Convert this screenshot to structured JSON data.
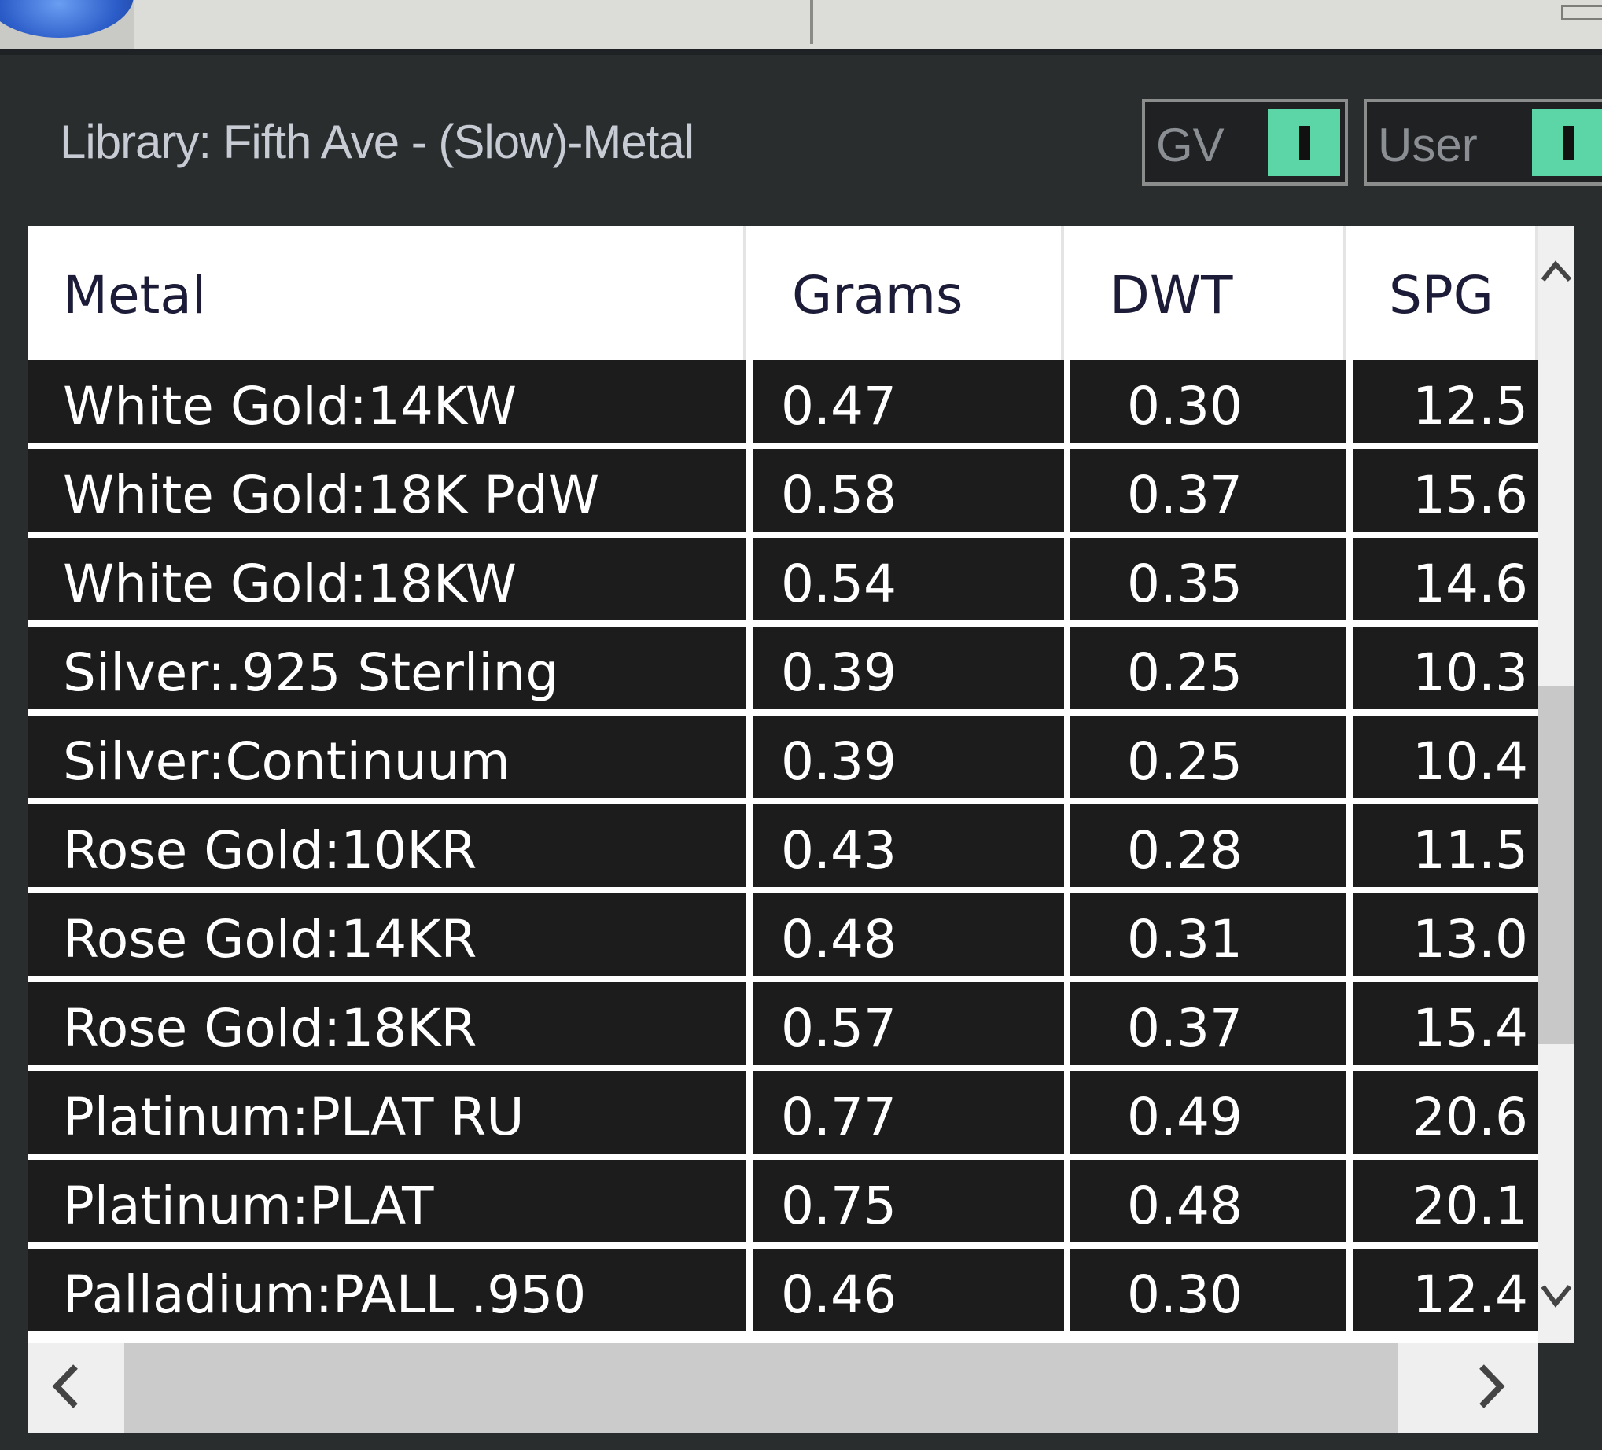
{
  "header": {
    "library_title": "Library: Fifth Ave - (Slow)-Metal",
    "toggles": [
      {
        "label": "GV",
        "state": "on"
      },
      {
        "label": "User",
        "state": "on"
      }
    ]
  },
  "table": {
    "columns": [
      "Metal",
      "Grams",
      "DWT",
      "SPG"
    ],
    "rows": [
      {
        "metal": "White Gold:14KW",
        "grams": "0.47",
        "dwt": "0.30",
        "spg": "12.5"
      },
      {
        "metal": "White Gold:18K PdW",
        "grams": "0.58",
        "dwt": "0.37",
        "spg": "15.6"
      },
      {
        "metal": "White Gold:18KW",
        "grams": "0.54",
        "dwt": "0.35",
        "spg": "14.6"
      },
      {
        "metal": "Silver:.925 Sterling",
        "grams": "0.39",
        "dwt": "0.25",
        "spg": "10.3"
      },
      {
        "metal": "Silver:Continuum",
        "grams": "0.39",
        "dwt": "0.25",
        "spg": "10.4"
      },
      {
        "metal": "Rose Gold:10KR",
        "grams": "0.43",
        "dwt": "0.28",
        "spg": "11.5"
      },
      {
        "metal": "Rose Gold:14KR",
        "grams": "0.48",
        "dwt": "0.31",
        "spg": "13.0"
      },
      {
        "metal": "Rose Gold:18KR",
        "grams": "0.57",
        "dwt": "0.37",
        "spg": "15.4"
      },
      {
        "metal": "Platinum:PLAT RU",
        "grams": "0.77",
        "dwt": "0.49",
        "spg": "20.6"
      },
      {
        "metal": "Platinum:PLAT",
        "grams": "0.75",
        "dwt": "0.48",
        "spg": "20.1"
      },
      {
        "metal": "Palladium:PALL .950",
        "grams": "0.46",
        "dwt": "0.30",
        "spg": "12.4"
      }
    ]
  },
  "scroll": {
    "up_arrow": "^",
    "down_arrow": "v",
    "left_arrow": "<",
    "right_arrow": ">"
  },
  "colors": {
    "background": "#2a2d2e",
    "row_background": "#1c1c1c",
    "header_text": "#1c1c38",
    "toggle_on": "#5dd6a7",
    "title_text": "#c7cbd4"
  }
}
